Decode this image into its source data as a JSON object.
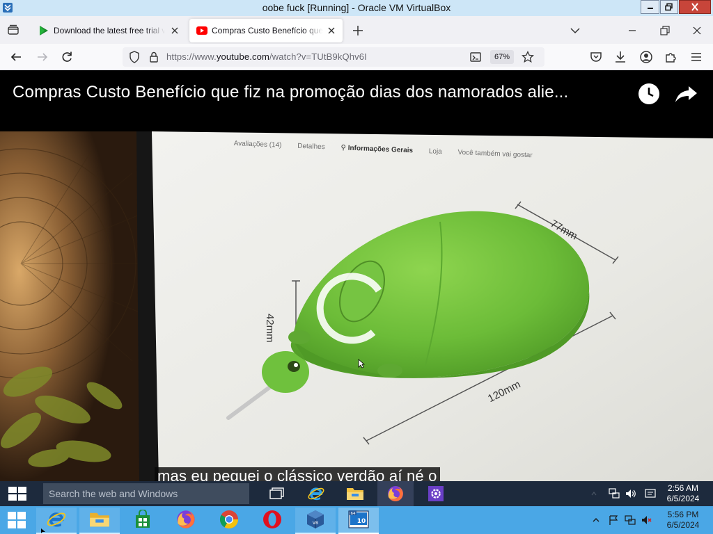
{
  "vm_window": {
    "title": "oobe fuck [Running] - Oracle VM VirtualBox"
  },
  "browser": {
    "tabs": [
      {
        "title": "Download the latest free trial ve",
        "favicon": "play-triangle-icon",
        "active": false
      },
      {
        "title": "Compras Custo Benefício que fiz",
        "favicon": "youtube-icon",
        "active": true
      }
    ],
    "url": {
      "prefix": "https://www.",
      "host": "youtube.com",
      "path": "/watch?v=TUtB9kQhv6I"
    },
    "zoom": "67%"
  },
  "video": {
    "title": "Compras Custo Benefício que fiz na promoção dias dos namorados alie...",
    "subtitle": "mas eu peguei o clássico verdão aí né o",
    "product_tabs": [
      "Avaliações (14)",
      "Detalhes",
      "Informações Gerais",
      "Loja",
      "Você também vai gostar"
    ],
    "active_product_tab": "Informações Gerais",
    "dimensions": {
      "width": "77mm",
      "height": "42mm",
      "length": "120mm"
    },
    "loading": true
  },
  "guest_taskbar": {
    "search_placeholder": "Search the web and Windows",
    "apps": [
      "task-view-icon",
      "internet-explorer-icon",
      "file-explorer-icon",
      "firefox-icon",
      "settings-icon"
    ],
    "active_app": "firefox-icon",
    "clock": {
      "time": "2:56 AM",
      "date": "6/5/2024"
    }
  },
  "host_taskbar": {
    "apps": [
      "internet-explorer-icon",
      "file-explorer-icon",
      "store-icon",
      "firefox-icon",
      "chrome-icon",
      "opera-icon",
      "virtualbox-icon",
      "virtualbox-vm-icon"
    ],
    "active_app": "virtualbox-vm-icon",
    "clock": {
      "time": "5:56 PM",
      "date": "6/5/2024"
    }
  },
  "colors": {
    "vbox_titlebar": "#cde6f7",
    "host_taskbar": "#4aa7e6",
    "guest_taskbar": "#1d2a3d",
    "turtle_green": "#6fc13d",
    "youtube_red": "#ff0000"
  }
}
